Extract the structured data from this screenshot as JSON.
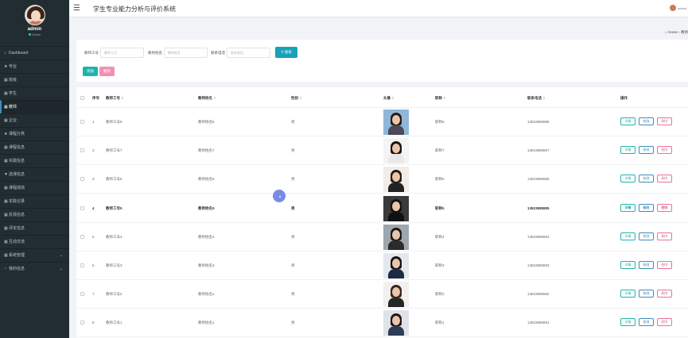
{
  "user": {
    "name": "admin",
    "status": "Online"
  },
  "sidebar": {
    "items": [
      {
        "icon": "circle-o",
        "label": "Dashboard"
      },
      {
        "icon": "star",
        "label": "专业"
      },
      {
        "icon": "grid",
        "label": "班级"
      },
      {
        "icon": "grid",
        "label": "学生"
      },
      {
        "icon": "grid",
        "label": "教师",
        "active": true
      },
      {
        "icon": "grid",
        "label": "企业"
      },
      {
        "icon": "star",
        "label": "课程分类"
      },
      {
        "icon": "grid",
        "label": "课程信息"
      },
      {
        "icon": "grid",
        "label": "实践信息"
      },
      {
        "icon": "filter",
        "label": "选课信息"
      },
      {
        "icon": "grid",
        "label": "课程成绩"
      },
      {
        "icon": "grid",
        "label": "实践记录"
      },
      {
        "icon": "grid",
        "label": "反馈信息"
      },
      {
        "icon": "grid",
        "label": "评定信息"
      },
      {
        "icon": "grid",
        "label": "互动交流"
      },
      {
        "icon": "grid",
        "label": "系统管理",
        "chevron": true
      },
      {
        "icon": "user",
        "label": "我的信息",
        "chevron": true
      }
    ]
  },
  "header": {
    "title": "学生专业能力分析与评价系统",
    "user_label": "admin"
  },
  "breadcrumb": {
    "home": "Home",
    "current": "教师"
  },
  "search": {
    "fields": [
      {
        "label": "教师工号",
        "placeholder": "教师工号"
      },
      {
        "label": "教师姓名",
        "placeholder": "教师姓名"
      },
      {
        "label": "联系电话",
        "placeholder": "联系电话"
      }
    ],
    "search_label": "搜索",
    "add_label": "添加",
    "delete_label": "删除"
  },
  "table": {
    "headers": [
      "序号",
      "教师工号",
      "教师姓名",
      "性别",
      "头像",
      "职称",
      "联系电话",
      "操作"
    ],
    "action_labels": {
      "detail": "详情",
      "edit": "修改",
      "delete": "删除"
    },
    "rows": [
      {
        "index": "1",
        "id": "教师工号8",
        "name": "教师姓名8",
        "gender": "男",
        "title": "职称8",
        "phone": "13823888888"
      },
      {
        "index": "2",
        "id": "教师工号7",
        "name": "教师姓名7",
        "gender": "男",
        "title": "职称7",
        "phone": "13823888887"
      },
      {
        "index": "3",
        "id": "教师工号6",
        "name": "教师姓名6",
        "gender": "男",
        "title": "职称6",
        "phone": "13823888886"
      },
      {
        "index": "4",
        "id": "教师工号5",
        "name": "教师姓名5",
        "gender": "男",
        "title": "职称5",
        "phone": "13823888885",
        "highlight": true
      },
      {
        "index": "5",
        "id": "教师工号4",
        "name": "教师姓名4",
        "gender": "男",
        "title": "职称4",
        "phone": "13823888884"
      },
      {
        "index": "6",
        "id": "教师工号3",
        "name": "教师姓名3",
        "gender": "男",
        "title": "职称3",
        "phone": "13823888883"
      },
      {
        "index": "7",
        "id": "教师工号2",
        "name": "教师姓名2",
        "gender": "男",
        "title": "职称2",
        "phone": "13823888882"
      },
      {
        "index": "8",
        "id": "教师工号1",
        "name": "教师姓名1",
        "gender": "男",
        "title": "职称1",
        "phone": "13823888881"
      }
    ]
  },
  "colors": {
    "sidebar_bg": "#222d32",
    "primary": "#17a2b8",
    "add": "#20b2aa",
    "delete": "#f48fb1"
  }
}
